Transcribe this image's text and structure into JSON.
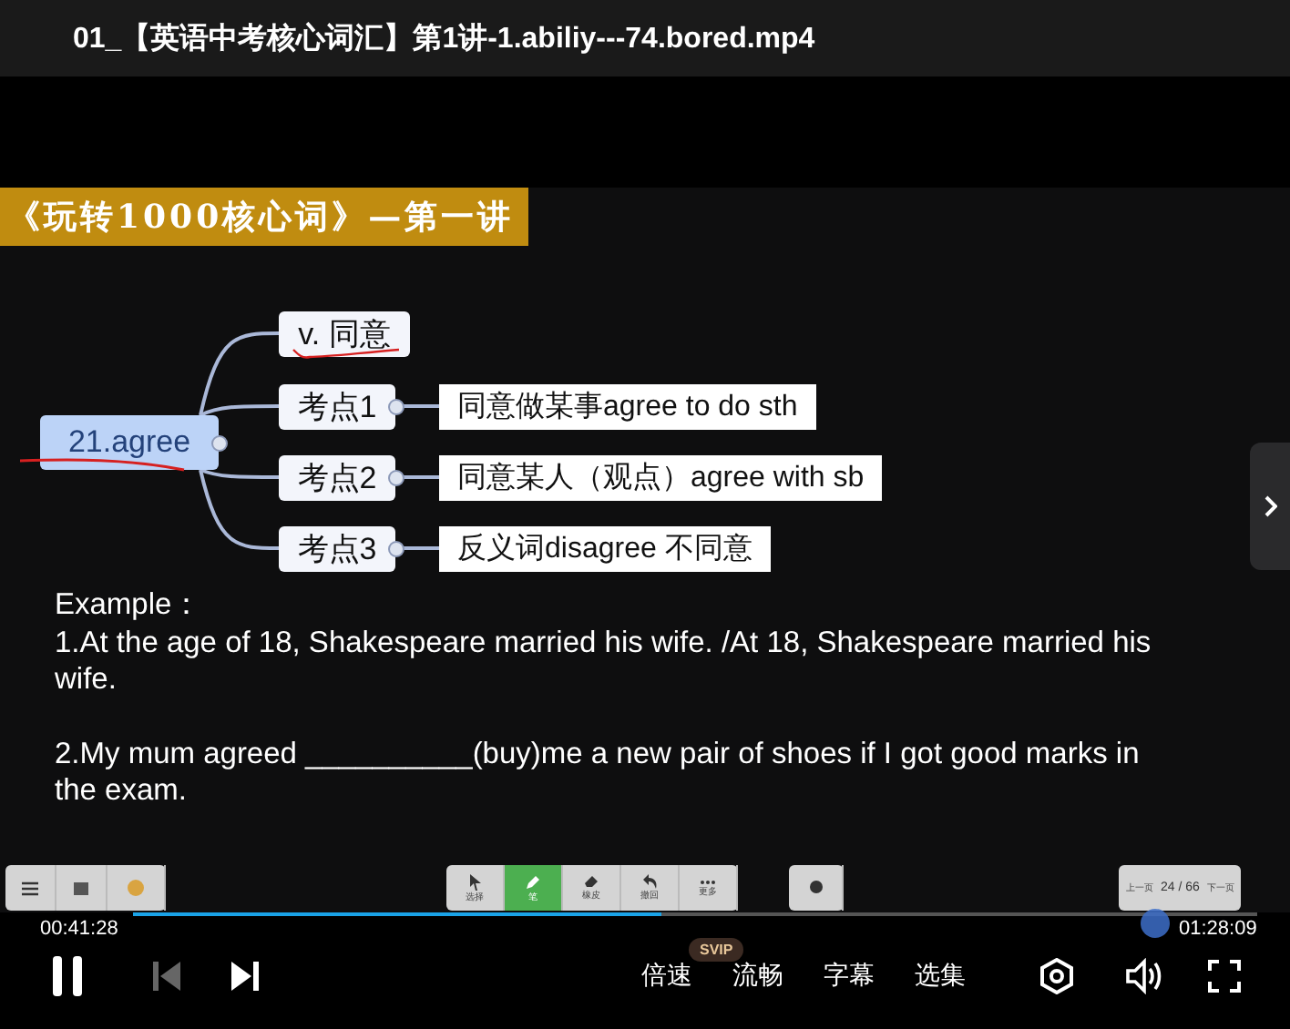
{
  "window": {
    "title": "01_【英语中考核心词汇】第1讲-1.abiliy---74.bored.mp4"
  },
  "slide": {
    "banner": "《玩转1000核心词》—第一讲",
    "mindmap": {
      "root": "21.agree",
      "nodes": [
        {
          "label": "v. 同意"
        },
        {
          "label": "考点1",
          "detail": "同意做某事agree to do sth"
        },
        {
          "label": "考点2",
          "detail": "同意某人（观点）agree with sb"
        },
        {
          "label": "考点3",
          "detail": "反义词disagree 不同意"
        }
      ]
    },
    "example": [
      "Example：",
      "1.At the age of 18, Shakespeare married his wife. /At 18, Shakespeare married his wife.",
      "2.My mum agreed __________(buy)me a new pair of shoes if I got good marks in the exam."
    ]
  },
  "toolbar": {
    "tools": [
      {
        "kind": "arrow",
        "label": "选择",
        "selected": false
      },
      {
        "kind": "pen",
        "label": "笔",
        "selected": true
      },
      {
        "kind": "eraser",
        "label": "橡皮",
        "selected": false
      },
      {
        "kind": "undo",
        "label": "撤回",
        "selected": false
      },
      {
        "kind": "more",
        "label": "更多",
        "selected": false
      }
    ],
    "page": {
      "prev": "上一页",
      "indicator": "24 / 66",
      "next": "下一页"
    }
  },
  "progress": {
    "elapsed": "00:41:28",
    "duration": "01:28:09",
    "level": 0.47
  },
  "controls": {
    "prev_disabled": true,
    "badge": "SVIP",
    "options": [
      "倍速",
      "流畅",
      "字幕",
      "选集"
    ]
  }
}
